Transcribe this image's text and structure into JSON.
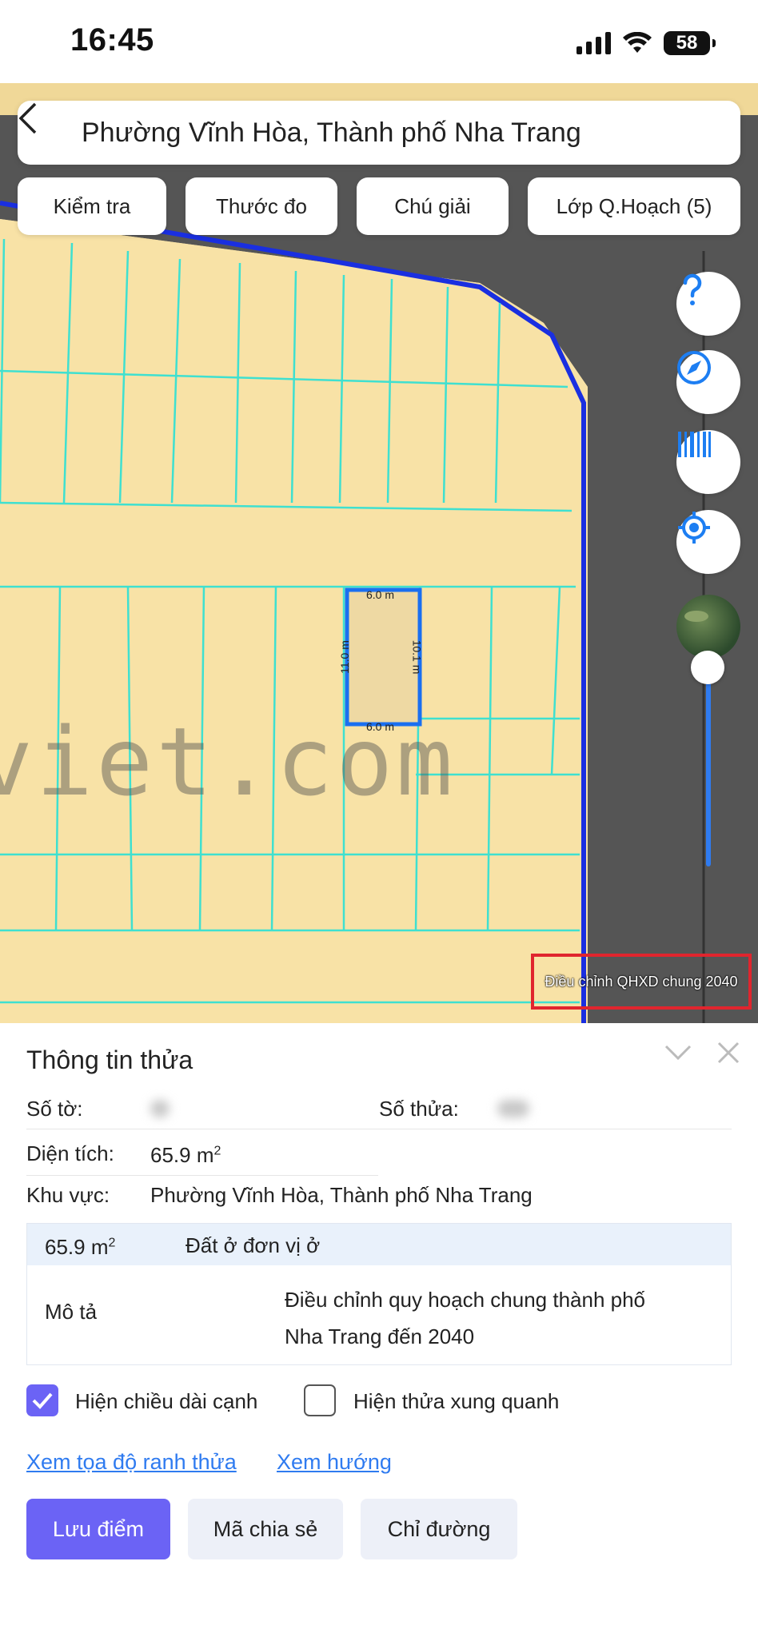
{
  "status": {
    "time": "16:45",
    "battery": "58"
  },
  "search": {
    "text": "Phường Vĩnh Hòa, Thành phố Nha Trang"
  },
  "toolbar": [
    "Kiểm tra",
    "Thước đo",
    "Chú giải",
    "Lớp Q.Hoạch (5)"
  ],
  "map": {
    "watermark": "viet.com",
    "plan_label": "Điều chỉnh QHXD chung 2040",
    "dims": {
      "top": "6.0 m",
      "bottom": "6.0 m",
      "left": "11.0 m",
      "right": "10.1 m"
    },
    "colors": {
      "land": "#f8e2a6",
      "road": "#555555",
      "boundary": "#1a2fe0",
      "parcel_lines": "#3fe0d0",
      "selected": "#1a6ff0"
    }
  },
  "side_buttons": [
    "help-icon",
    "compass-icon",
    "barcode-icon",
    "locate-icon",
    "satellite-layer"
  ],
  "panel": {
    "title": "Thông tin thửa",
    "so_to_label": "Số tờ:",
    "so_thua_label": "Số thửa:",
    "dien_tich_label": "Diện tích:",
    "dien_tich_value": "65.9 m",
    "khu_vuc_label": "Khu vực:",
    "khu_vuc_value": "Phường Vĩnh Hòa, Thành phố Nha Trang",
    "zone": {
      "area": "65.9 m",
      "type": "Đất ở đơn vị ở",
      "desc_label": "Mô tả",
      "desc_line1": "Điều chỉnh quy hoạch chung thành phố",
      "desc_line2": "Nha Trang đến 2040"
    },
    "checkbox1": {
      "label": "Hiện chiều dài cạnh",
      "checked": true
    },
    "checkbox2": {
      "label": "Hiện thửa xung quanh",
      "checked": false
    },
    "link1": "Xem tọa độ ranh thửa",
    "link2": "Xem hướng",
    "buttons": {
      "save": "Lưu điểm",
      "share": "Mã chia sẻ",
      "directions": "Chỉ đường"
    },
    "accent": "#6b63f5"
  }
}
